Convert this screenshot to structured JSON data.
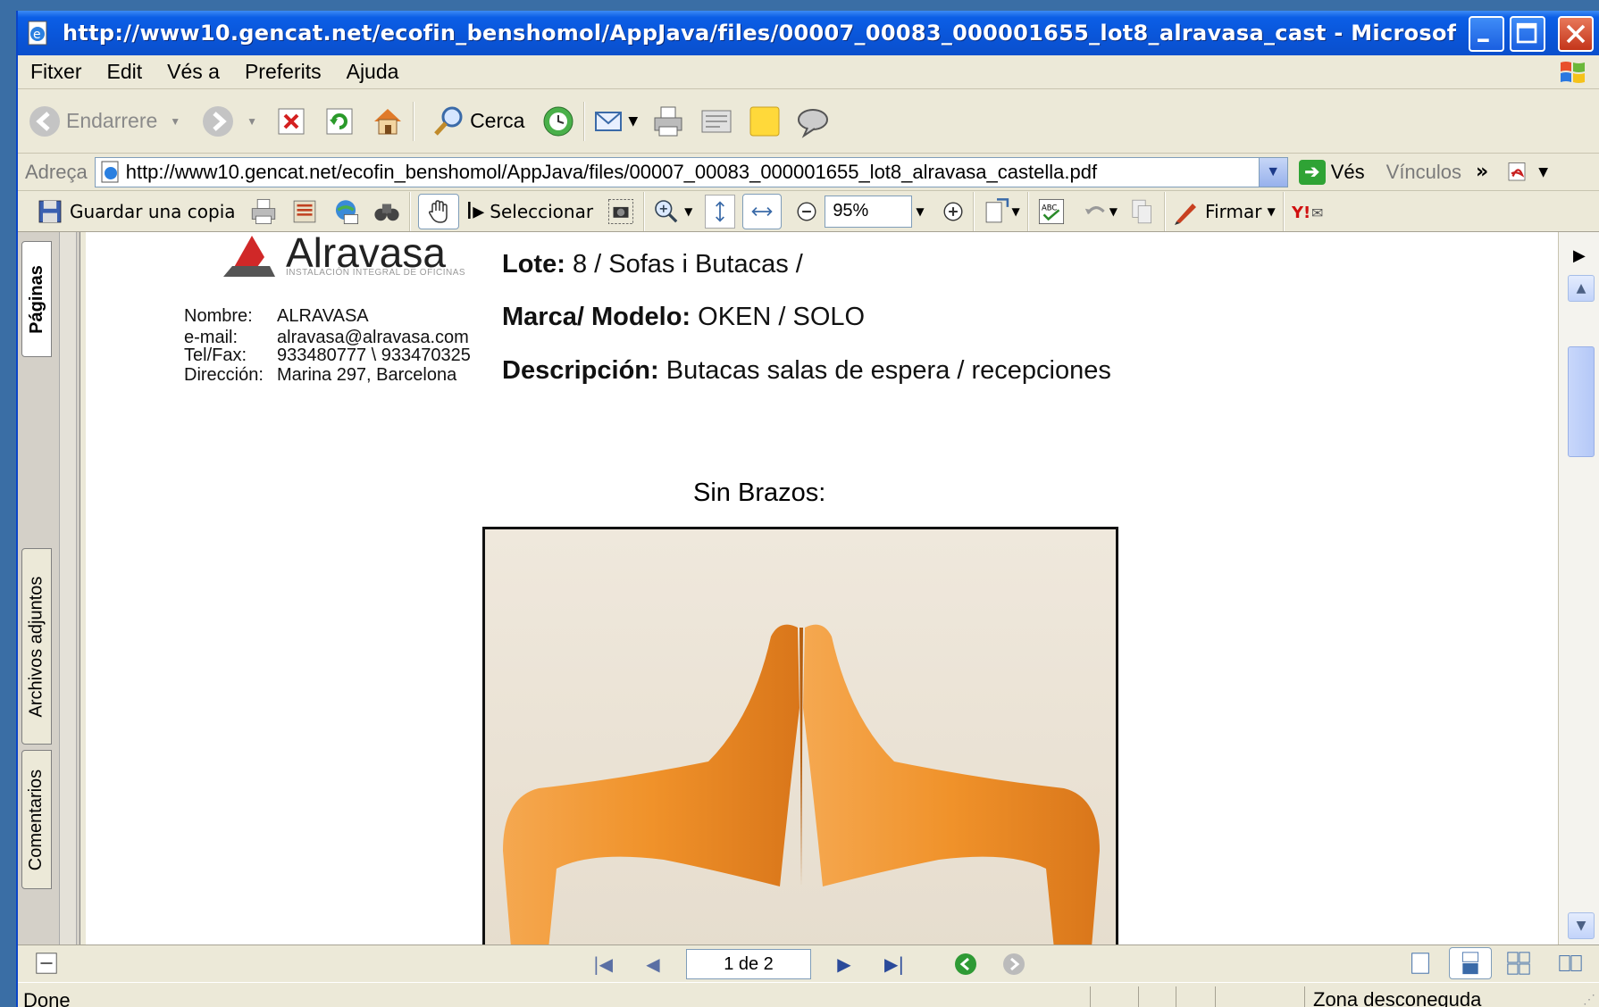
{
  "window": {
    "title": "http://www10.gencat.net/ecofin_benshomol/AppJava/files/00007_00083_000001655_lot8_alravasa_cast - Microsof..."
  },
  "menu": {
    "items": [
      "Fitxer",
      "Edit",
      "Vés a",
      "Preferits",
      "Ajuda"
    ]
  },
  "toolbar": {
    "back_label": "Endarrere",
    "search_label": "Cerca"
  },
  "address": {
    "label": "Adreça",
    "url": "http://www10.gencat.net/ecofin_benshomol/AppJava/files/00007_00083_000001655_lot8_alravasa_castella.pdf",
    "go_label": "Vés",
    "links_label": "Vínculos"
  },
  "adobe_toolbar": {
    "save_copy_label": "Guardar una copia",
    "select_label": "Seleccionar",
    "zoom_value": "95%",
    "sign_label": "Firmar"
  },
  "side_tabs": [
    "Páginas",
    "Archivos adjuntos",
    "Comentarios"
  ],
  "document": {
    "logo_name": "Alravasa",
    "logo_tagline": "INSTALACIÓN INTEGRAL DE OFICINAS",
    "contact": [
      {
        "key": "Nombre:",
        "value": "ALRAVASA"
      },
      {
        "key": "e-mail:",
        "value": "alravasa@alravasa.com"
      },
      {
        "key": "Tel/Fax:",
        "value": "933480777 \\ 933470325"
      },
      {
        "key": "Dirección:",
        "value": "Marina 297, Barcelona"
      }
    ],
    "lote_label": "Lote:",
    "lote_value": "8 / Sofas i Butacas /",
    "marca_label": "Marca/ Modelo:",
    "marca_value": "OKEN / SOLO",
    "desc_label": "Descripción:",
    "desc_value": "Butacas salas de espera / recepciones",
    "subheading": "Sin Brazos:"
  },
  "navigation": {
    "page_indicator": "1 de 2"
  },
  "status": {
    "left": "Done",
    "zone": "Zona desconeguda"
  }
}
